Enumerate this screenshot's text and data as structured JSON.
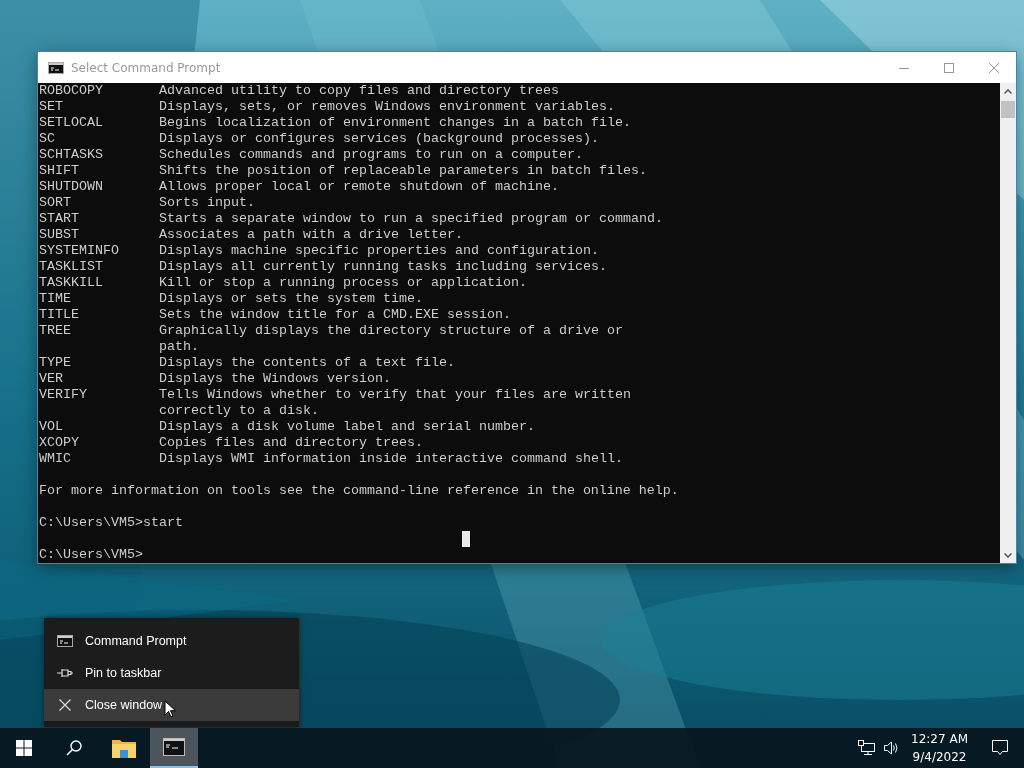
{
  "window": {
    "title": "Select Command Prompt"
  },
  "console": {
    "commands": [
      {
        "name": "ROBOCOPY",
        "description_lines": [
          "Advanced utility to copy files and directory trees"
        ]
      },
      {
        "name": "SET",
        "description_lines": [
          "Displays, sets, or removes Windows environment variables."
        ]
      },
      {
        "name": "SETLOCAL",
        "description_lines": [
          "Begins localization of environment changes in a batch file."
        ]
      },
      {
        "name": "SC",
        "description_lines": [
          "Displays or configures services (background processes)."
        ]
      },
      {
        "name": "SCHTASKS",
        "description_lines": [
          "Schedules commands and programs to run on a computer."
        ]
      },
      {
        "name": "SHIFT",
        "description_lines": [
          "Shifts the position of replaceable parameters in batch files."
        ]
      },
      {
        "name": "SHUTDOWN",
        "description_lines": [
          "Allows proper local or remote shutdown of machine."
        ]
      },
      {
        "name": "SORT",
        "description_lines": [
          "Sorts input."
        ]
      },
      {
        "name": "START",
        "description_lines": [
          "Starts a separate window to run a specified program or command."
        ]
      },
      {
        "name": "SUBST",
        "description_lines": [
          "Associates a path with a drive letter."
        ]
      },
      {
        "name": "SYSTEMINFO",
        "description_lines": [
          "Displays machine specific properties and configuration."
        ]
      },
      {
        "name": "TASKLIST",
        "description_lines": [
          "Displays all currently running tasks including services."
        ]
      },
      {
        "name": "TASKKILL",
        "description_lines": [
          "Kill or stop a running process or application."
        ]
      },
      {
        "name": "TIME",
        "description_lines": [
          "Displays or sets the system time."
        ]
      },
      {
        "name": "TITLE",
        "description_lines": [
          "Sets the window title for a CMD.EXE session."
        ]
      },
      {
        "name": "TREE",
        "description_lines": [
          "Graphically displays the directory structure of a drive or",
          "path."
        ]
      },
      {
        "name": "TYPE",
        "description_lines": [
          "Displays the contents of a text file."
        ]
      },
      {
        "name": "VER",
        "description_lines": [
          "Displays the Windows version."
        ]
      },
      {
        "name": "VERIFY",
        "description_lines": [
          "Tells Windows whether to verify that your files are written",
          "correctly to a disk."
        ]
      },
      {
        "name": "VOL",
        "description_lines": [
          "Displays a disk volume label and serial number."
        ]
      },
      {
        "name": "XCOPY",
        "description_lines": [
          "Copies files and directory trees."
        ]
      },
      {
        "name": "WMIC",
        "description_lines": [
          "Displays WMI information inside interactive command shell."
        ]
      }
    ],
    "info": "For more information on tools see the command-line reference in the online help.",
    "prompts": [
      "C:\\Users\\VM5>start",
      "C:\\Users\\VM5>"
    ]
  },
  "jump_list": {
    "items": [
      {
        "label": "Command Prompt",
        "kind": "app",
        "selected": false
      },
      {
        "label": "Pin to taskbar",
        "kind": "pin",
        "selected": false
      },
      {
        "label": "Close window",
        "kind": "close",
        "selected": true
      }
    ]
  },
  "taskbar": {
    "apps": [
      {
        "kind": "start",
        "active": false
      },
      {
        "kind": "search",
        "active": false
      },
      {
        "kind": "explorer",
        "active": false
      },
      {
        "kind": "terminal",
        "active": true
      }
    ],
    "tray": {
      "time": "12:27 AM",
      "date": "9/4/2022"
    }
  }
}
